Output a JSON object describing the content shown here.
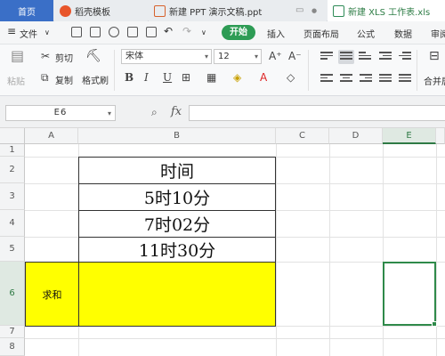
{
  "tabs": {
    "home": "首页",
    "daoke": "稻壳模板",
    "ppt": "新建 PPT 演示文稿.ppt",
    "xls": "新建 XLS 工作表.xls"
  },
  "menu": {
    "file": "文件",
    "start": "开始",
    "insert": "插入",
    "page_layout": "页面布局",
    "formula": "公式",
    "data": "数据",
    "review": "审阅"
  },
  "ribbon": {
    "cut": "剪切",
    "paste": "粘贴",
    "copy": "复制",
    "format_painter": "格式刷",
    "font_name": "宋体",
    "font_size": "12",
    "merge": "合并居"
  },
  "formula_bar": {
    "cell_ref": "E6",
    "fx": "fx",
    "value": ""
  },
  "sheet": {
    "columns": [
      "A",
      "B",
      "C",
      "D",
      "E"
    ],
    "selected_column": "E",
    "rows": [
      "1",
      "2",
      "3",
      "4",
      "5",
      "6",
      "7",
      "8"
    ],
    "selected_row": "6",
    "cells": {
      "B2": "时间",
      "B3": "5时10分",
      "B4": "7时02分",
      "B5": "11时30分",
      "A6": "求和"
    },
    "highlight_color": "#ffff00",
    "selection_color": "#2f8a4a",
    "active_cell": "E6"
  }
}
